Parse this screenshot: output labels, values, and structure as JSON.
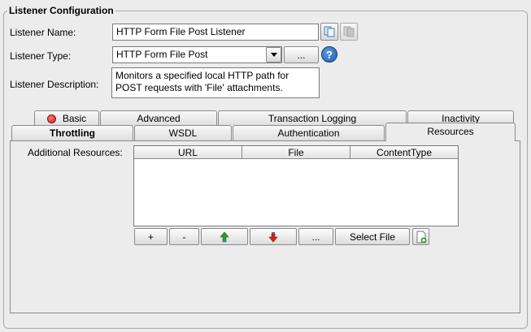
{
  "group": {
    "title": "Listener Configuration"
  },
  "listener_name": {
    "label": "Listener Name:",
    "value": "HTTP Form File Post Listener"
  },
  "listener_type": {
    "label": "Listener Type:",
    "value": "HTTP Form File Post",
    "browse_label": "...",
    "help_icon": "?"
  },
  "listener_description": {
    "label": "Listener Description:",
    "line1": "Monitors a specified local HTTP path for",
    "line2": "POST requests with 'File' attachments."
  },
  "tabs_row1": [
    {
      "label": "Basic",
      "icon": "red-circle-icon"
    },
    {
      "label": "Advanced"
    },
    {
      "label": "Transaction Logging"
    },
    {
      "label": "Inactivity"
    }
  ],
  "tabs_row2": [
    {
      "label": "Throttling"
    },
    {
      "label": "WSDL"
    },
    {
      "label": "Authentication"
    },
    {
      "label": "Resources",
      "selected": true
    }
  ],
  "resources": {
    "label": "Additional Resources:",
    "columns": [
      "URL",
      "File",
      "ContentType"
    ],
    "rows": [],
    "buttons": {
      "add": "+",
      "remove": "-",
      "browse": "...",
      "select_file": "Select File"
    }
  },
  "colors": {
    "help_blue": "#1f5fa8",
    "basic_status_red": "#d11a1a",
    "arrow_green": "#2e9a35",
    "arrow_red": "#d22222"
  }
}
